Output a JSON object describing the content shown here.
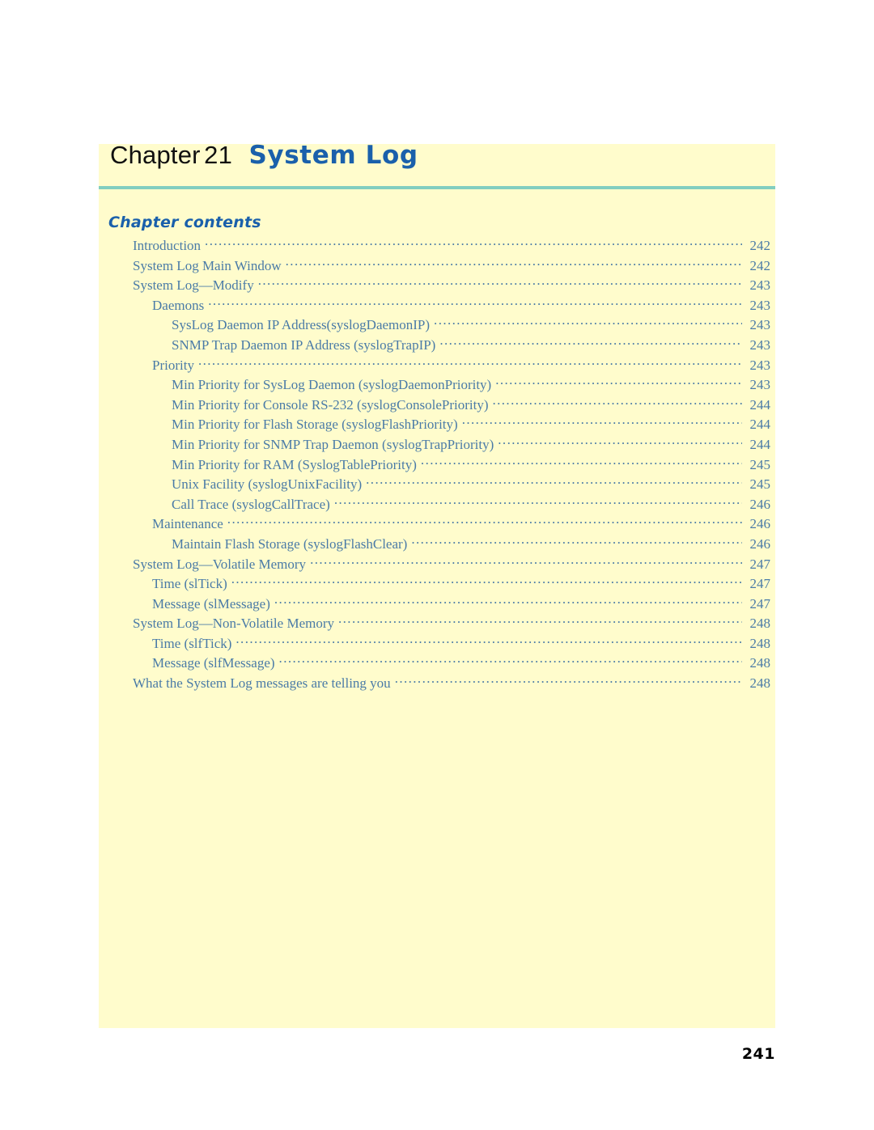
{
  "header": {
    "chapter_word": "Chapter",
    "chapter_number": "21",
    "chapter_title": "System Log"
  },
  "contents": {
    "heading": "Chapter contents",
    "entries": [
      {
        "label": "Introduction",
        "page": "242",
        "level": 0
      },
      {
        "label": "System Log Main Window",
        "page": "242",
        "level": 0
      },
      {
        "label": "System Log—Modify",
        "page": "243",
        "level": 0
      },
      {
        "label": "Daemons",
        "page": "243",
        "level": 1
      },
      {
        "label": "SysLog Daemon IP Address(syslogDaemonIP)",
        "page": "243",
        "level": 2
      },
      {
        "label": "SNMP Trap Daemon IP Address (syslogTrapIP)",
        "page": "243",
        "level": 2
      },
      {
        "label": "Priority",
        "page": "243",
        "level": 1
      },
      {
        "label": "Min Priority for SysLog Daemon (syslogDaemonPriority)",
        "page": "243",
        "level": 2
      },
      {
        "label": "Min Priority for Console RS-232 (syslogConsolePriority)",
        "page": "244",
        "level": 2
      },
      {
        "label": "Min Priority for Flash Storage (syslogFlashPriority)",
        "page": "244",
        "level": 2
      },
      {
        "label": "Min Priority for SNMP Trap Daemon (syslogTrapPriority)",
        "page": "244",
        "level": 2
      },
      {
        "label": "Min Priority for RAM (SyslogTablePriority)",
        "page": "245",
        "level": 2
      },
      {
        "label": "Unix Facility (syslogUnixFacility)",
        "page": "245",
        "level": 2
      },
      {
        "label": "Call Trace (syslogCallTrace)",
        "page": "246",
        "level": 2
      },
      {
        "label": "Maintenance",
        "page": "246",
        "level": 1
      },
      {
        "label": "Maintain Flash Storage (syslogFlashClear)",
        "page": "246",
        "level": 2
      },
      {
        "label": "System Log—Volatile Memory",
        "page": "247",
        "level": 0
      },
      {
        "label": "Time (slTick)",
        "page": "247",
        "level": 1
      },
      {
        "label": "Message (slMessage)",
        "page": "247",
        "level": 1
      },
      {
        "label": "System Log—Non-Volatile Memory",
        "page": "248",
        "level": 0
      },
      {
        "label": "Time (slfTick)",
        "page": "248",
        "level": 1
      },
      {
        "label": "Message (slfMessage)",
        "page": "248",
        "level": 1
      },
      {
        "label": "What the System Log messages are telling you",
        "page": "248",
        "level": 0
      }
    ]
  },
  "folio": {
    "page_number": "241"
  },
  "colors": {
    "panel_background": "#fffccc",
    "title_blue": "#1a60ab",
    "toc_blue": "#4a7ba7",
    "rule_teal": "#82cec0",
    "folio_black": "#000000"
  }
}
